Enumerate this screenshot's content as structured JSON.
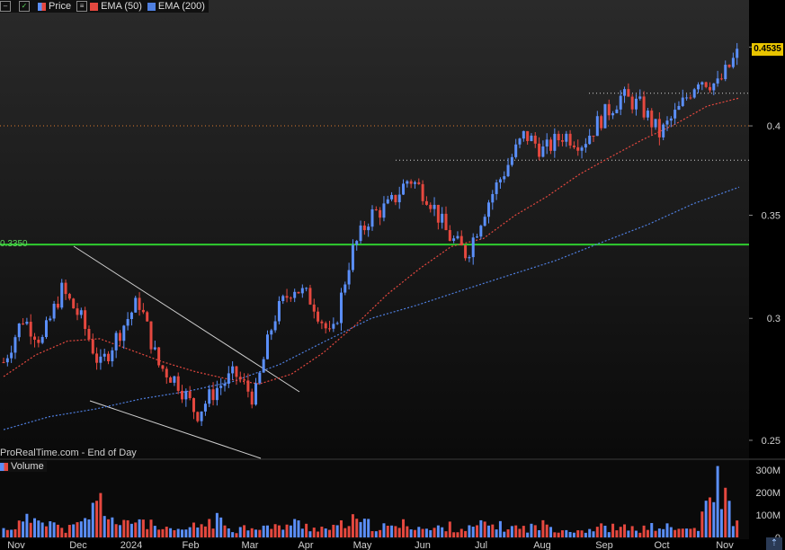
{
  "legend": {
    "price": "Price",
    "ema50": "EMA (50)",
    "ema200": "EMA (200)"
  },
  "volume_label": "Volume",
  "watermark": "ProRealTime.com - End of Day",
  "level_label": "0.3350",
  "last_price": "0.4535",
  "colors": {
    "up": "#5b8ff9",
    "down": "#e5483f",
    "ema50": "#e5483f",
    "ema200": "#4f7fe0",
    "level": "#2fcc2f",
    "resistance_dotted": "#e07a2f",
    "badge": "#e8c400"
  },
  "chart_data": [
    {
      "type": "line",
      "title": "",
      "x_labels": [
        "Nov",
        "Dec",
        "2024",
        "Feb",
        "Mar",
        "Apr",
        "May",
        "Jun",
        "Jul",
        "Aug",
        "Sep",
        "Oct",
        "Nov"
      ],
      "y_ticks": [
        0.25,
        0.3,
        0.35,
        0.4,
        0.45
      ],
      "y_tick_labels": [
        "0.25",
        "0.3",
        "0.35",
        "0.4",
        "0.45"
      ],
      "ylim": [
        0.245,
        0.47
      ],
      "series": [
        {
          "name": "Price",
          "values": [
            0.281,
            0.3,
            0.29,
            0.313,
            0.3,
            0.279,
            0.294,
            0.308,
            0.28,
            0.273,
            0.26,
            0.27,
            0.276,
            0.266,
            0.3,
            0.315,
            0.308,
            0.29,
            0.33,
            0.35,
            0.355,
            0.37,
            0.36,
            0.34,
            0.33,
            0.355,
            0.375,
            0.395,
            0.385,
            0.395,
            0.39,
            0.405,
            0.418,
            0.412,
            0.395,
            0.41,
            0.43,
            0.425,
            0.445
          ]
        },
        {
          "name": "EMA (50)",
          "values": [
            0.275,
            0.284,
            0.29,
            0.291,
            0.286,
            0.281,
            0.277,
            0.274,
            0.272,
            0.276,
            0.285,
            0.297,
            0.311,
            0.323,
            0.334,
            0.338,
            0.35,
            0.36,
            0.372,
            0.382,
            0.392,
            0.401,
            0.412,
            0.417
          ]
        },
        {
          "name": "EMA (200)",
          "values": [
            0.254,
            0.259,
            0.262,
            0.266,
            0.269,
            0.273,
            0.28,
            0.29,
            0.3,
            0.306,
            0.313,
            0.32,
            0.327,
            0.336,
            0.345,
            0.356,
            0.365
          ]
        }
      ],
      "horizontal_levels": [
        {
          "value": 0.335,
          "style": "solid"
        },
        {
          "value": 0.4,
          "style": "dotted"
        },
        {
          "value": 0.38,
          "style": "dotted"
        },
        {
          "value": 0.42,
          "style": "dotted"
        }
      ],
      "last_value": 0.4535
    },
    {
      "type": "bar",
      "title": "Volume",
      "y_ticks": [
        0,
        100,
        200,
        300
      ],
      "y_tick_labels": [
        "0",
        "100M",
        "200M",
        "300M"
      ],
      "ylim": [
        0,
        320
      ],
      "values": [
        40,
        70,
        120,
        35,
        60,
        180,
        50,
        95,
        40,
        30,
        55,
        85,
        40,
        60,
        45,
        70,
        50,
        40,
        80,
        60,
        45,
        70,
        35,
        55,
        40,
        65,
        50,
        45,
        60,
        40,
        35,
        50,
        45,
        40,
        55,
        38,
        45,
        270,
        60
      ]
    }
  ]
}
